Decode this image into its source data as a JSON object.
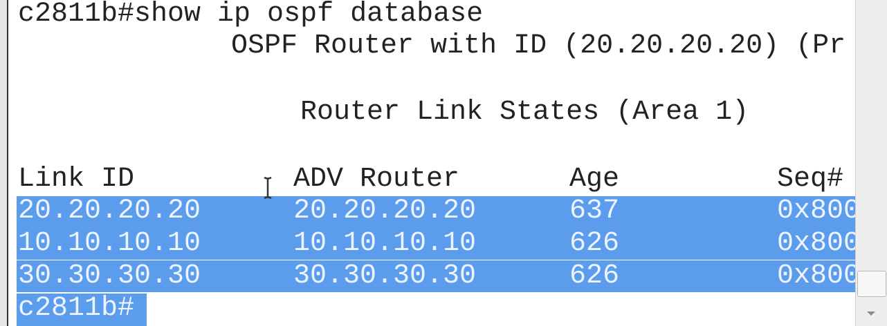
{
  "terminal": {
    "command_line": "c2811b#show ip ospf database",
    "router_id_line": "OSPF Router with ID (20.20.20.20) (Pr",
    "section_title": "Router Link States (Area 1)",
    "headers": {
      "link_id": "Link ID",
      "adv_router": "ADV Router",
      "age": "Age",
      "seq": "Seq#"
    },
    "rows": [
      {
        "link_id": "20.20.20.20",
        "adv_router": "20.20.20.20",
        "age": "637",
        "seq": "0x800"
      },
      {
        "link_id": "10.10.10.10",
        "adv_router": "10.10.10.10",
        "age": "626",
        "seq": "0x800"
      },
      {
        "link_id": "30.30.30.30",
        "adv_router": "30.30.30.30",
        "age": "626",
        "seq": "0x800"
      }
    ],
    "prompt": "c2811b#"
  },
  "colors": {
    "selection": "#5c9cec",
    "text": "#222222",
    "selected_text": "#eef4ff"
  },
  "icons": {
    "cursor": "i-beam-cursor-icon",
    "scroll_down": "chevron-down-icon"
  }
}
